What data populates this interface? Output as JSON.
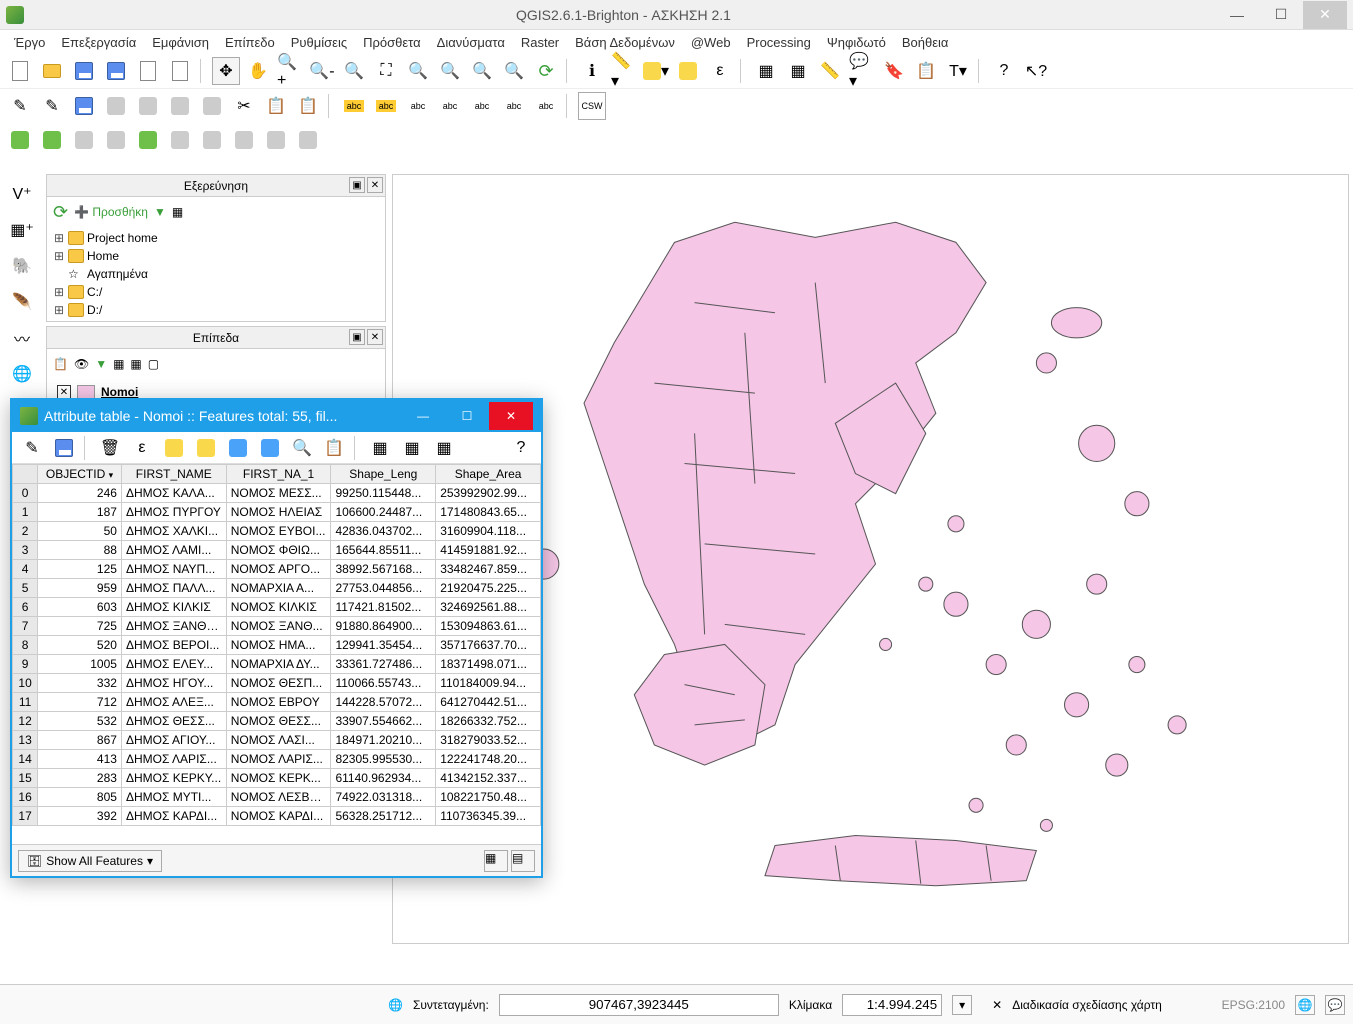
{
  "window": {
    "title": "QGIS2.6.1-Brighton - ΑΣΚΗΣΗ 2.1"
  },
  "menus": [
    "Έργο",
    "Επεξεργασία",
    "Εμφάνιση",
    "Επίπεδο",
    "Ρυθμίσεις",
    "Πρόσθετα",
    "Διανύσματα",
    "Raster",
    "Βάση Δεδομένων",
    "@Web",
    "Processing",
    "Ψηφιδωτό",
    "Βοήθεια"
  ],
  "panels": {
    "browser": {
      "title": "Εξερεύνηση",
      "add_label": "Προσθήκη",
      "items": [
        "Project home",
        "Home",
        "Αγαπημένα",
        "C:/",
        "D:/"
      ]
    },
    "layers": {
      "title": "Επίπεδα",
      "layer_name": "Nomoi"
    }
  },
  "attribute_dialog": {
    "title": "Attribute table - Nomoi :: Features total: 55, fil...",
    "columns": [
      "OBJECTID",
      "FIRST_NAME",
      "FIRST_NA_1",
      "Shape_Leng",
      "Shape_Area"
    ],
    "rows": [
      {
        "i": "0",
        "id": "246",
        "fn": "ΔΗΜΟΣ ΚΑΛΑ...",
        "fn1": "ΝΟΜΟΣ ΜΕΣΣ...",
        "len": "99250.115448...",
        "area": "253992902.99..."
      },
      {
        "i": "1",
        "id": "187",
        "fn": "ΔΗΜΟΣ ΠΥΡΓΟΥ",
        "fn1": "ΝΟΜΟΣ ΗΛΕΙΑΣ",
        "len": "106600.24487...",
        "area": "171480843.65..."
      },
      {
        "i": "2",
        "id": "50",
        "fn": "ΔΗΜΟΣ ΧΑΛΚΙ...",
        "fn1": "ΝΟΜΟΣ ΕΥΒΟΙ...",
        "len": "42836.043702...",
        "area": "31609904.118..."
      },
      {
        "i": "3",
        "id": "88",
        "fn": "ΔΗΜΟΣ ΛΑΜΙ...",
        "fn1": "ΝΟΜΟΣ ΦΘΙΩ...",
        "len": "165644.85511...",
        "area": "414591881.92..."
      },
      {
        "i": "4",
        "id": "125",
        "fn": "ΔΗΜΟΣ ΝΑΥΠ...",
        "fn1": "ΝΟΜΟΣ ΑΡΓΟ...",
        "len": "38992.567168...",
        "area": "33482467.859..."
      },
      {
        "i": "5",
        "id": "959",
        "fn": "ΔΗΜΟΣ ΠΑΛΛ...",
        "fn1": "ΝΟΜΑΡΧΙΑ Α...",
        "len": "27753.044856...",
        "area": "21920475.225..."
      },
      {
        "i": "6",
        "id": "603",
        "fn": "ΔΗΜΟΣ ΚΙΛΚΙΣ",
        "fn1": "ΝΟΜΟΣ ΚΙΛΚΙΣ",
        "len": "117421.81502...",
        "area": "324692561.88..."
      },
      {
        "i": "7",
        "id": "725",
        "fn": "ΔΗΜΟΣ ΞΑΝΘΗΣ",
        "fn1": "ΝΟΜΟΣ ΞΑΝΘ...",
        "len": "91880.864900...",
        "area": "153094863.61..."
      },
      {
        "i": "8",
        "id": "520",
        "fn": "ΔΗΜΟΣ ΒΕΡΟΙ...",
        "fn1": "ΝΟΜΟΣ ΗΜΑ...",
        "len": "129941.35454...",
        "area": "357176637.70..."
      },
      {
        "i": "9",
        "id": "1005",
        "fn": "ΔΗΜΟΣ ΕΛΕΥ...",
        "fn1": "ΝΟΜΑΡΧΙΑ ΔΥ...",
        "len": "33361.727486...",
        "area": "18371498.071..."
      },
      {
        "i": "10",
        "id": "332",
        "fn": "ΔΗΜΟΣ ΗΓΟΥ...",
        "fn1": "ΝΟΜΟΣ ΘΕΣΠ...",
        "len": "110066.55743...",
        "area": "110184009.94..."
      },
      {
        "i": "11",
        "id": "712",
        "fn": "ΔΗΜΟΣ ΑΛΕΞ...",
        "fn1": "ΝΟΜΟΣ ΕΒΡΟΥ",
        "len": "144228.57072...",
        "area": "641270442.51..."
      },
      {
        "i": "12",
        "id": "532",
        "fn": "ΔΗΜΟΣ ΘΕΣΣ...",
        "fn1": "ΝΟΜΟΣ ΘΕΣΣ...",
        "len": "33907.554662...",
        "area": "18266332.752..."
      },
      {
        "i": "13",
        "id": "867",
        "fn": "ΔΗΜΟΣ ΑΓΙΟΥ...",
        "fn1": "ΝΟΜΟΣ ΛΑΣΙ...",
        "len": "184971.20210...",
        "area": "318279033.52..."
      },
      {
        "i": "14",
        "id": "413",
        "fn": "ΔΗΜΟΣ ΛΑΡΙΣ...",
        "fn1": "ΝΟΜΟΣ ΛΑΡΙΣ...",
        "len": "82305.995530...",
        "area": "122241748.20..."
      },
      {
        "i": "15",
        "id": "283",
        "fn": "ΔΗΜΟΣ ΚΕΡΚΥ...",
        "fn1": "ΝΟΜΟΣ ΚΕΡΚ...",
        "len": "61140.962934...",
        "area": "41342152.337..."
      },
      {
        "i": "16",
        "id": "805",
        "fn": "ΔΗΜΟΣ ΜΥΤΙ...",
        "fn1": "ΝΟΜΟΣ ΛΕΣΒΟΥ",
        "len": "74922.031318...",
        "area": "108221750.48..."
      },
      {
        "i": "17",
        "id": "392",
        "fn": "ΔΗΜΟΣ ΚΑΡΔΙ...",
        "fn1": "ΝΟΜΟΣ ΚΑΡΔΙ...",
        "len": "56328.251712...",
        "area": "110736345.39..."
      }
    ],
    "footer_label": "Show All Features"
  },
  "statusbar": {
    "coord_label": "Συντεταγμένη:",
    "coord_value": "907467,3923445",
    "scale_label": "Κλίμακα",
    "scale_value": "1:4.994.245",
    "render_label": "Διαδικασία σχεδίασης χάρτη",
    "crs": "EPSG:2100"
  }
}
